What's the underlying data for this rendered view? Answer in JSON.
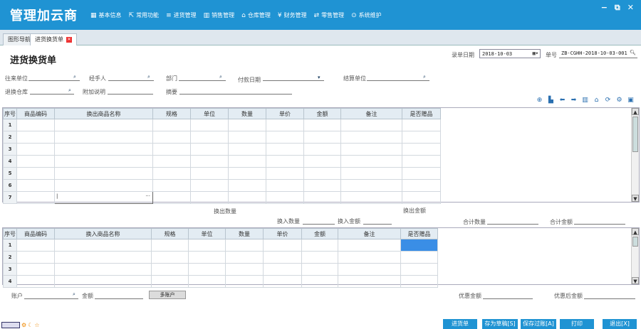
{
  "app": {
    "title": "管理加云商"
  },
  "menu": [
    {
      "icon": "▦",
      "label": "基本信息"
    },
    {
      "icon": "⇱",
      "label": "常用功能"
    },
    {
      "icon": "≡",
      "label": "进货管理"
    },
    {
      "icon": "▥",
      "label": "销售管理"
    },
    {
      "icon": "⌂",
      "label": "仓库管理"
    },
    {
      "icon": "¥",
      "label": "财务管理"
    },
    {
      "icon": "⇄",
      "label": "零售管理"
    },
    {
      "icon": "⊙",
      "label": "系统维护"
    }
  ],
  "window_controls": {
    "minimize": "−",
    "restore": "⧉",
    "close": "✕"
  },
  "tabs": {
    "tab1": "图形导航",
    "tab2": "进货换货单",
    "close": "✕"
  },
  "page": {
    "title": "进货换货单"
  },
  "header_fields": {
    "record_date_label": "录单日期",
    "record_date_value": "2018-10-03",
    "doc_no_label": "单号",
    "doc_no_value": "ZB-CGHH-2018-10-03-001"
  },
  "form": {
    "partner": "往来单位",
    "handler": "经手人",
    "department": "部门",
    "pay_date": "付款日期",
    "settle_unit": "结算单位",
    "warehouse": "退换仓库",
    "note": "附加说明",
    "summary": "摘要"
  },
  "toolbar_icons": [
    "plus-icon",
    "chart-icon",
    "left-arrow-icon",
    "right-arrow-icon",
    "barcode-icon",
    "home-icon",
    "refresh-icon",
    "gear-icon",
    "print-icon"
  ],
  "out_grid": {
    "columns": [
      "序号",
      "商品编码",
      "换出商品名称",
      "规格",
      "单位",
      "数量",
      "单价",
      "金额",
      "备注",
      "是否赠品"
    ],
    "rows": [
      "1",
      "2",
      "3",
      "4",
      "5",
      "6",
      "7"
    ],
    "cell_ellipsis": "···"
  },
  "mid_labels": {
    "out_qty": "换出数量",
    "out_amount": "换出金额",
    "in_qty": "换入数量",
    "in_amount": "换入金额",
    "total_qty": "合计数量",
    "total_amount": "合计金额"
  },
  "in_grid": {
    "columns": [
      "序号",
      "商品编码",
      "换入商品名称",
      "规格",
      "单位",
      "数量",
      "单价",
      "金额",
      "备注",
      "是否赠品"
    ],
    "rows": [
      "1",
      "2",
      "3",
      "4"
    ]
  },
  "footer": {
    "account": "账户",
    "amount": "金额",
    "multi_account": "多账户",
    "discount_amount": "优惠金额",
    "after_discount": "优惠后金额"
  },
  "buttons": {
    "purchase_order": "进货单",
    "save_draft": "存为草稿[S]",
    "save_post": "保存过账[A]",
    "print": "打印",
    "exit": "退出[X]"
  },
  "tray": {
    "icon1": "⚙",
    "icon2": "☾",
    "icon3": "☆"
  }
}
